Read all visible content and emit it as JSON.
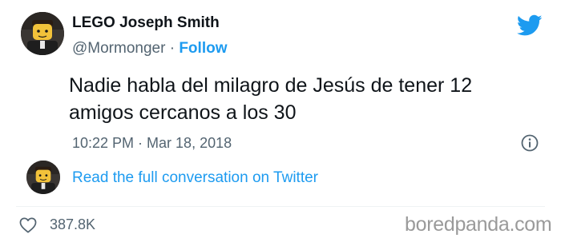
{
  "author": {
    "name": "LEGO Joseph Smith",
    "handle": "@Mormonger",
    "separator": "·",
    "follow_label": "Follow",
    "avatar_icon": "lego-minifigure-avatar"
  },
  "tweet": {
    "text_line1": "Nadie habla del milagro de Jesús de tener 12",
    "text_line2": "amigos cercanos a los 30",
    "timestamp": "10:22 PM · Mar 18, 2018"
  },
  "footer": {
    "read_conversation_label": "Read the full conversation on Twitter",
    "like_count": "387.8K"
  },
  "watermark": "boredpanda.com",
  "icons": [
    "twitter-bird-icon",
    "info-icon",
    "heart-icon"
  ],
  "colors": {
    "accent": "#1d9bf0",
    "text": "#0f1419",
    "secondary": "#536471",
    "divider": "#eff3f4",
    "watermark": "#9a9a9a"
  }
}
